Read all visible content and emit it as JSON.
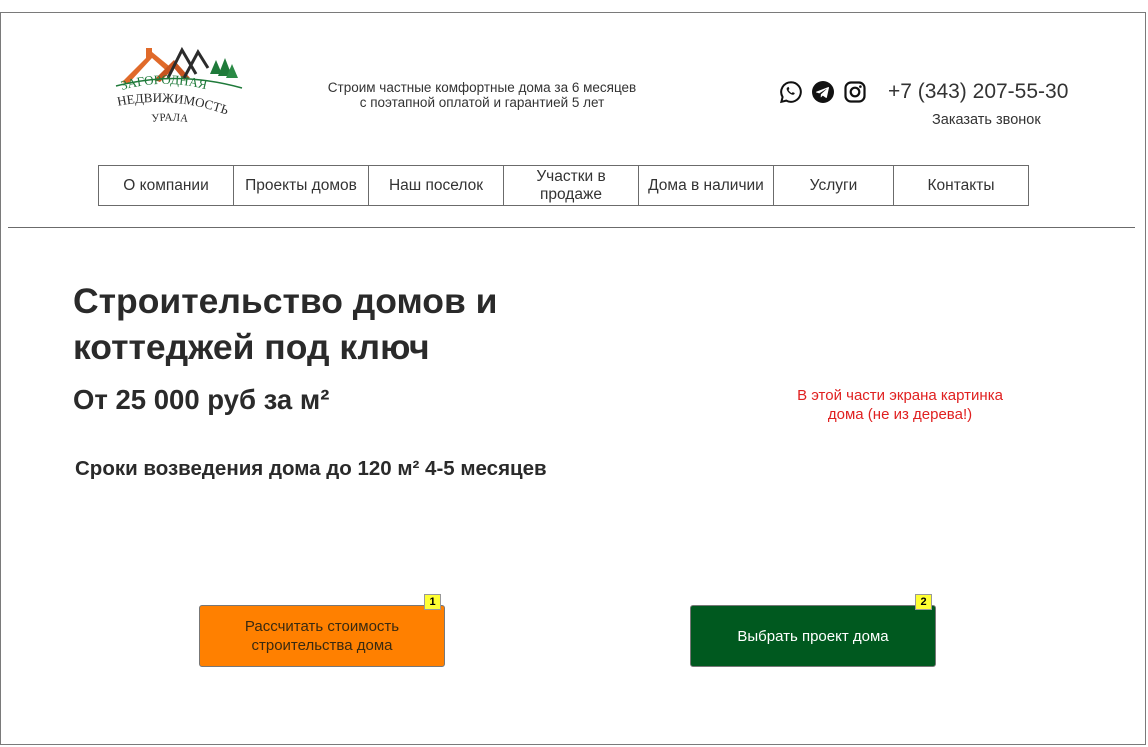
{
  "header": {
    "logo": {
      "line1": "ЗАГОРОДНАЯ",
      "line2": "НЕДВИЖИМОСТЬ",
      "line3": "УРАЛА"
    },
    "tagline": {
      "line1": "Строим частные комфортные дома за 6 месяцев",
      "line2": "с поэтапной оплатой и гарантией 5 лет"
    },
    "social_icons": [
      "whatsapp-icon",
      "telegram-icon",
      "instagram-icon"
    ],
    "phone": "+7 (343) 207-55-30",
    "callback_label": "Заказать звонок"
  },
  "nav": {
    "items": [
      {
        "label": "О компании"
      },
      {
        "label": "Проекты домов"
      },
      {
        "label": "Наш поселок"
      },
      {
        "label": "Участки в продаже"
      },
      {
        "label": "Дома в наличии"
      },
      {
        "label": "Услуги"
      },
      {
        "label": "Контакты"
      }
    ]
  },
  "hero": {
    "title_line1": "Строительство домов и",
    "title_line2": "коттеджей под ключ",
    "price": "От 25 000 руб за м²",
    "terms": "Сроки возведения дома  до 120 м² 4-5 месяцев",
    "image_note_line1": "В этой части экрана картинка",
    "image_note_line2": "дома (не из дерева!)"
  },
  "buttons": {
    "calc_line1": "Рассчитать стоимость",
    "calc_line2": "строительства дома",
    "calc_badge": "1",
    "project_label": "Выбрать проект дома",
    "project_badge": "2"
  },
  "colors": {
    "orange_button": "#ff8000",
    "green_button": "#00591f",
    "note_red": "#e02020",
    "badge_yellow": "#ffff33"
  }
}
